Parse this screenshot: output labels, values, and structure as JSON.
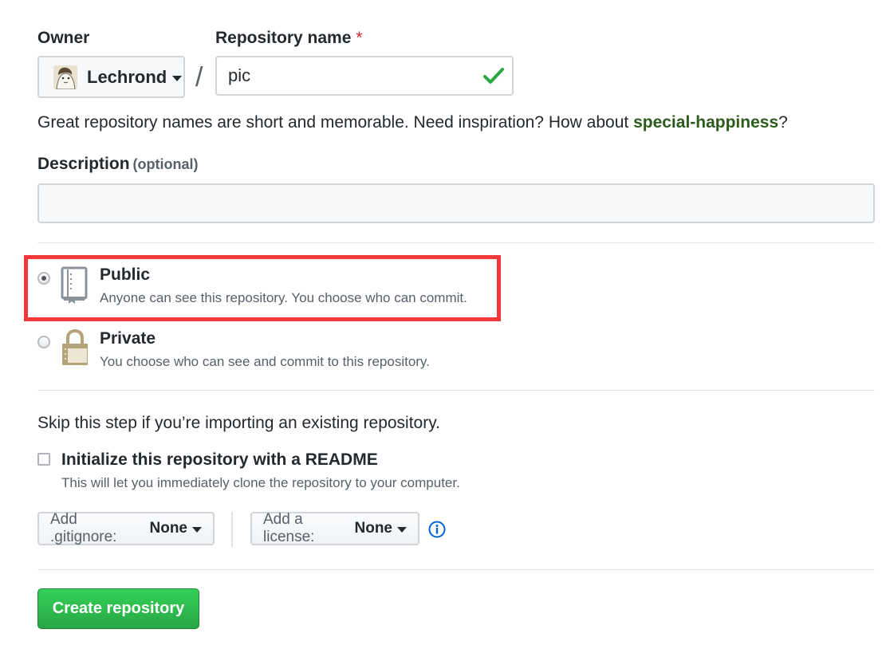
{
  "owner": {
    "label": "Owner",
    "name": "Lechrond"
  },
  "separator": "/",
  "repo": {
    "label": "Repository name",
    "required_mark": "*",
    "value": "pic"
  },
  "hint": {
    "text": "Great repository names are short and memorable. Need inspiration? How about ",
    "suggestion": "special-happiness",
    "end": "?"
  },
  "description": {
    "label": "Description",
    "optional": "(optional)",
    "value": ""
  },
  "visibility": {
    "public": {
      "title": "Public",
      "desc": "Anyone can see this repository. You choose who can commit.",
      "selected": true
    },
    "private": {
      "title": "Private",
      "desc": "You choose who can see and commit to this repository.",
      "selected": false
    }
  },
  "skip_text": "Skip this step if you’re importing an existing repository.",
  "readme": {
    "label": "Initialize this repository with a README",
    "desc": "This will let you immediately clone the repository to your computer.",
    "checked": false
  },
  "gitignore": {
    "prefix": "Add .gitignore:",
    "value": "None"
  },
  "license": {
    "prefix": "Add a license:",
    "value": "None"
  },
  "create_button": "Create repository",
  "colors": {
    "accent_green": "#28a745",
    "suggestion_green": "#2c5b1c",
    "highlight_red": "#f2373a",
    "info_blue": "#0366d6"
  }
}
